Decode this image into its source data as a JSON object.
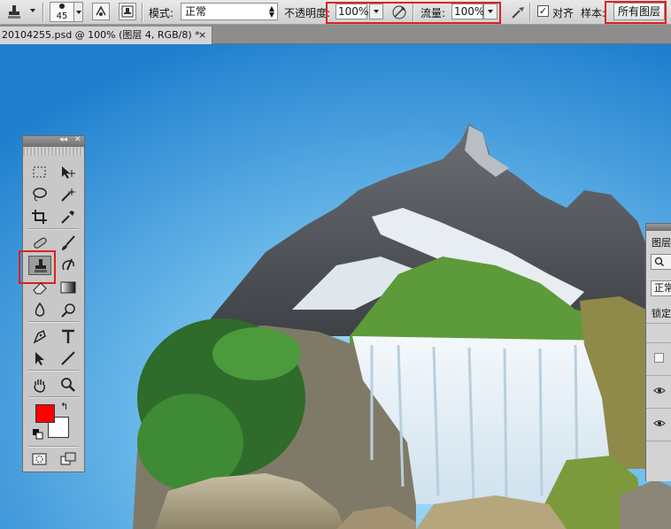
{
  "options_bar": {
    "tool_icon": "clone-stamp-icon",
    "brush_size": "45",
    "mode_label": "模式:",
    "mode_value": "正常",
    "opacity_label": "不透明度:",
    "opacity_value": "100%",
    "flow_label": "流量:",
    "flow_value": "100%",
    "align_label": "对齐",
    "align_checked": true,
    "sample_label": "样本:",
    "sample_value": "所有图层"
  },
  "document_tab": {
    "title": "20104255.psd @ 100% (图层 4, RGB/8) *",
    "close": "×"
  },
  "toolbox": {
    "collapse": "◂◂",
    "close": "✕",
    "foreground_color": "#ff0000",
    "background_color": "#ffffff",
    "active_tool": "clone-stamp-tool"
  },
  "layers_panel": {
    "title": "图层",
    "search_icon": "search-icon",
    "blend_mode": "正常",
    "lock_label": "锁定"
  },
  "colors": {
    "highlight_box": "#e02020",
    "sky_top": "#3a9be0",
    "sky_bottom": "#9dd8f7"
  }
}
